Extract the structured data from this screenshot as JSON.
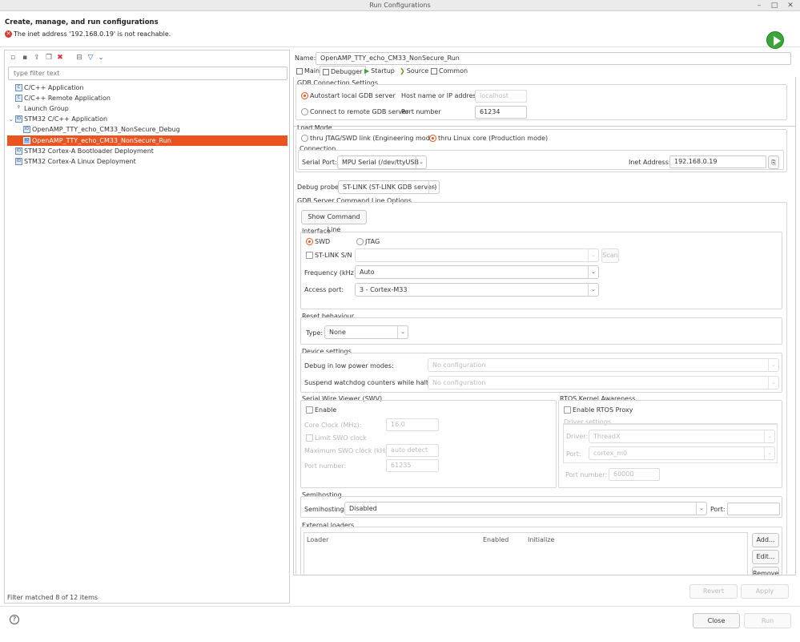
{
  "window": {
    "title": "Run Configurations",
    "controls": [
      "minimize-icon",
      "maximize-icon",
      "close-icon"
    ]
  },
  "header": {
    "title": "Create, manage, and run configurations",
    "error": "The inet address '192.168.0.19' is not reachable."
  },
  "left": {
    "toolbar_icons": [
      "new-config-icon",
      "new-prototype-icon",
      "export-icon",
      "duplicate-icon",
      "delete-icon",
      "collapse-all-icon",
      "filter-icon",
      "dropdown-icon"
    ],
    "filter_placeholder": "type filter text",
    "tree": [
      {
        "label": "C/C++ Application",
        "level": 0
      },
      {
        "label": "C/C++ Remote Application",
        "level": 0
      },
      {
        "label": "Launch Group",
        "level": 0
      },
      {
        "label": "STM32 C/C++ Application",
        "level": 0,
        "expanded": true
      },
      {
        "label": "OpenAMP_TTY_echo_CM33_NonSecure_Debug",
        "level": 1
      },
      {
        "label": "OpenAMP_TTY_echo_CM33_NonSecure_Run",
        "level": 1,
        "selected": true
      },
      {
        "label": "STM32 Cortex-A Bootloader Deployment",
        "level": 0
      },
      {
        "label": "STM32 Cortex-A Linux Deployment",
        "level": 0
      }
    ],
    "status": "Filter matched 8 of 12 items"
  },
  "right": {
    "name_label": "Name:",
    "name_value": "OpenAMP_TTY_echo_CM33_NonSecure_Run",
    "tabs": [
      "Main",
      "Debugger",
      "Startup",
      "Source",
      "Common"
    ],
    "active_tab": "Debugger",
    "gdb": {
      "title": "GDB Connection Settings",
      "autostart": "Autostart local GDB server",
      "host_label": "Host name or IP address",
      "host_value": "localhost",
      "remote": "Connect to remote GDB server",
      "port_label": "Port number",
      "port_value": "61234"
    },
    "load": {
      "title": "Load Mode",
      "jtag": "thru JTAG/SWD link (Engineering mode)",
      "linux": "thru Linux core (Production mode)",
      "connection_title": "Connection",
      "serial_label": "Serial Port:",
      "serial_value": "MPU Serial (/dev/ttyUSB",
      "inet_label": "Inet Address:",
      "inet_value": "192.168.0.19"
    },
    "probe": {
      "label": "Debug probe",
      "value": "ST-LINK (ST-LINK GDB server)"
    },
    "gdbserver": {
      "title": "GDB Server Command Line Options",
      "show_cmd": "Show Command Line",
      "interface_title": "Interface",
      "swd": "SWD",
      "jtag": "JTAG",
      "stlink_sn": "ST-LINK S/N",
      "scan": "Scan",
      "freq_label": "Frequency (kHz):",
      "freq_value": "Auto",
      "access_label": "Access port:",
      "access_value": "3 - Cortex-M33",
      "reset_title": "Reset behaviour",
      "type_label": "Type:",
      "type_value": "None",
      "device_title": "Device settings",
      "low_power_label": "Debug in low power modes:",
      "low_power_value": "No configuration",
      "watchdog_label": "Suspend watchdog counters while halted:",
      "watchdog_value": "No configuration",
      "swv_title": "Serial Wire Viewer (SWV)",
      "swv_enable": "Enable",
      "core_clock_label": "Core Clock (MHz):",
      "core_clock_value": "16.0",
      "limit_swo": "Limit SWO clock",
      "max_swo_label": "Maximum SWO clock (kHz):",
      "max_swo_value": "auto detect",
      "swv_port_label": "Port number:",
      "swv_port_value": "61235",
      "rtos_title": "RTOS Kernel Awareness",
      "rtos_enable": "Enable RTOS Proxy",
      "driver_title": "Driver settings",
      "driver_label": "Driver:",
      "driver_value": "ThreadX",
      "drv_port_label": "Port:",
      "drv_port_value": "cortex_m0",
      "rtos_port_label": "Port number:",
      "rtos_port_value": "60000",
      "semi_title": "Semihosting",
      "semi_label": "Semihosting:",
      "semi_value": "Disabled",
      "semi_port_label": "Port:",
      "ext_title": "External loaders",
      "ext_cols": [
        "Loader",
        "Enabled",
        "Initialize"
      ],
      "ext_add": "Add...",
      "ext_edit": "Edit...",
      "ext_remove": "Remove"
    },
    "revert": "Revert",
    "apply": "Apply"
  },
  "footer": {
    "close": "Close",
    "run": "Run"
  }
}
